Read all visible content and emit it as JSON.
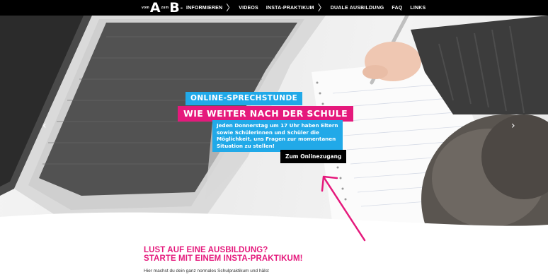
{
  "logo": {
    "prefix": "vom",
    "first": "A",
    "middle": "zum",
    "second": "B",
    "dash": "-"
  },
  "nav": {
    "items": [
      {
        "label": "INFORMIEREN",
        "chevron": true
      },
      {
        "label": "VIDEOS",
        "chevron": false
      },
      {
        "label": "INSTA-PRAKTIKUM",
        "chevron": true
      },
      {
        "label": "DUALE AUSBILDUNG",
        "chevron": false
      },
      {
        "label": "FAQ",
        "chevron": false
      },
      {
        "label": "LINKS",
        "chevron": false
      }
    ],
    "chevron_glyph": "〉"
  },
  "hero": {
    "prev_arrow": "‹",
    "next_arrow": "›",
    "line1": "ONLINE-SPRECHSTUNDE",
    "line2": "WIE WEITER NACH DER SCHULE",
    "body": "Jeden Donnerstag um 17 Uhr haben Eltern sowie Schülerinnen und Schüler die Möglichkeit, uns Fragen zur momentanen Situation zu stellen!",
    "cta": "Zum Onlinezugang"
  },
  "section": {
    "title_line1": "LUST AUF EINE AUSBILDUNG?",
    "title_line2": "STARTE MIT EINEM INSTA-PRAKTIKUM!",
    "text": "Hier machst du dein ganz normales Schulpraktikum und hälst"
  },
  "colors": {
    "pink": "#e5197c",
    "blue": "#21a9e8",
    "black": "#000000"
  }
}
